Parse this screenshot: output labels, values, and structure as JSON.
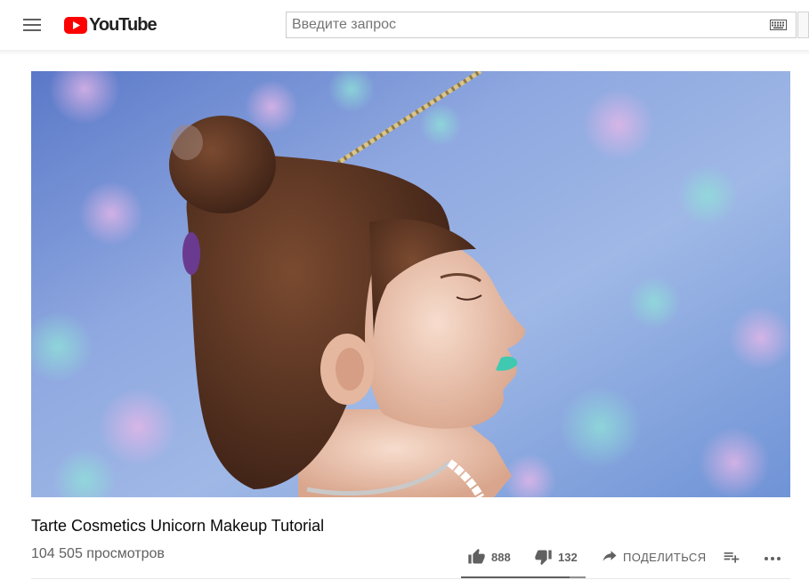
{
  "header": {
    "logo_text": "YouTube",
    "search": {
      "placeholder": "Введите запрос",
      "value": ""
    }
  },
  "video": {
    "title": "Tarte Cosmetics Unicorn Makeup Tutorial",
    "views": "104 505 просмотров"
  },
  "actions": {
    "likes": "888",
    "dislikes": "132",
    "share_label": "ПОДЕЛИТЬСЯ"
  },
  "sentiment": {
    "like_ratio": 0.87
  },
  "colors": {
    "brand_red": "#ff0000",
    "icon_gray": "#606060"
  }
}
